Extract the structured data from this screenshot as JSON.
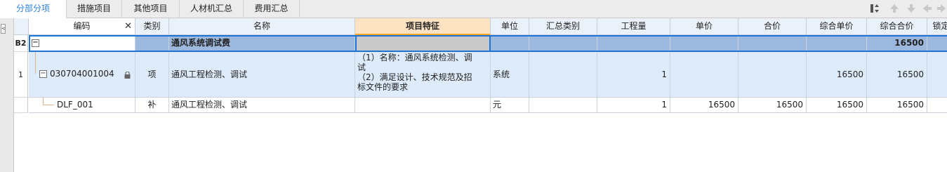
{
  "tabs": [
    {
      "label": "分部分项",
      "active": true
    },
    {
      "label": "措施项目"
    },
    {
      "label": "其他项目"
    },
    {
      "label": "人材机汇总"
    },
    {
      "label": "费用汇总"
    }
  ],
  "toolbar": {
    "icons": [
      "sort-icon",
      "move-top-icon",
      "move-down-icon",
      "arrow-left-icon",
      "arrow-right-icon"
    ],
    "colors": {
      "disabled": "#c8c8c8",
      "enabled": "#555555"
    }
  },
  "gutter": {
    "collapse_glyph": "<"
  },
  "columns": {
    "code": "编码",
    "type": "类别",
    "name": "名称",
    "feature": "项目特征",
    "unit": "单位",
    "summary": "汇总类别",
    "qty": "工程量",
    "unit_price": "单价",
    "total_price": "合价",
    "comp_unit": "综合单价",
    "comp_total": "综合合价",
    "lock": "锁定"
  },
  "rows": [
    {
      "index": "B2",
      "code": "",
      "type": "",
      "name": "通风系统调试费",
      "feature": "",
      "unit": "",
      "summary": "",
      "qty": "",
      "unit_price": "",
      "total_price": "",
      "comp_unit": "",
      "comp_total": "16500"
    },
    {
      "index": "1",
      "code": "030704001004",
      "type": "项",
      "name": "通风工程检测、调试",
      "feature_lines": [
        "（1）名称：通风系统检测、调",
        "试",
        "（2）满足设计、技术规范及招",
        "标文件的要求"
      ],
      "unit": "系统",
      "summary": "",
      "qty": "1",
      "unit_price": "",
      "total_price": "",
      "comp_unit": "16500",
      "comp_total": "16500"
    },
    {
      "index": "",
      "code": "DLF_001",
      "type": "补",
      "name": "通风工程检测、调试",
      "feature": "",
      "unit": "元",
      "summary": "",
      "qty": "1",
      "unit_price": "16500",
      "total_price": "16500",
      "comp_unit": "16500",
      "comp_total": "16500"
    }
  ],
  "colors": {
    "active_tab_text": "#2d7fd3",
    "selected_header": "#fde3c2",
    "group_row": "#9cb8dd",
    "item_row": "#deebfa",
    "selection_border": "#1e73d6"
  }
}
